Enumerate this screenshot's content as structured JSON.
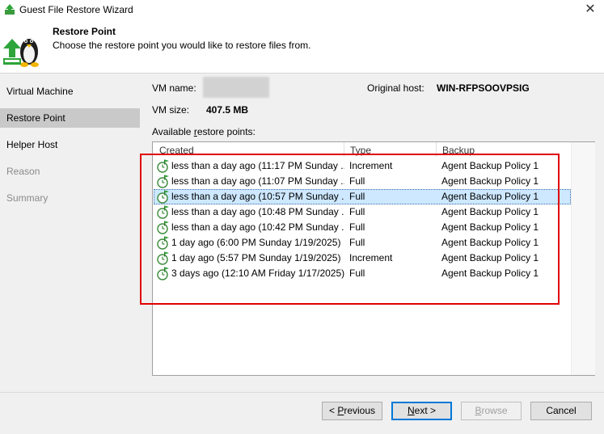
{
  "window": {
    "title": "Guest File Restore Wizard",
    "close_symbol": "✕"
  },
  "header": {
    "title": "Restore Point",
    "description": "Choose the restore point you would like to restore files from."
  },
  "sidebar": {
    "items": [
      {
        "label": "Virtual Machine",
        "state": "normal"
      },
      {
        "label": "Restore Point",
        "state": "active"
      },
      {
        "label": "Helper Host",
        "state": "normal"
      },
      {
        "label": "Reason",
        "state": "disabled"
      },
      {
        "label": "Summary",
        "state": "disabled"
      }
    ]
  },
  "vm": {
    "name_label": "VM name:",
    "size_label": "VM size:",
    "size_value": "407.5 MB",
    "original_host_label": "Original host:",
    "original_host_value": "WIN-RFPSOOVPSIG"
  },
  "restore_points": {
    "label_prefix": "Available ",
    "label_underlined": "r",
    "label_suffix": "estore points:",
    "columns": [
      "Created",
      "Type",
      "Backup"
    ],
    "rows": [
      {
        "created": "less than a day ago (11:17 PM Sunday ...",
        "type": "Increment",
        "backup": "Agent Backup Policy 1",
        "selected": false
      },
      {
        "created": "less than a day ago (11:07 PM Sunday ...",
        "type": "Full",
        "backup": "Agent Backup Policy 1",
        "selected": false
      },
      {
        "created": "less than a day ago (10:57 PM Sunday ...",
        "type": "Full",
        "backup": "Agent Backup Policy 1",
        "selected": true
      },
      {
        "created": "less than a day ago (10:48 PM Sunday ...",
        "type": "Full",
        "backup": "Agent Backup Policy 1",
        "selected": false
      },
      {
        "created": "less than a day ago (10:42 PM Sunday ...",
        "type": "Full",
        "backup": "Agent Backup Policy 1",
        "selected": false
      },
      {
        "created": "1 day ago (6:00 PM Sunday 1/19/2025)",
        "type": "Full",
        "backup": "Agent Backup Policy 1",
        "selected": false
      },
      {
        "created": "1 day ago (5:57 PM Sunday 1/19/2025)",
        "type": "Increment",
        "backup": "Agent Backup Policy 1",
        "selected": false
      },
      {
        "created": "3 days ago (12:10 AM Friday 1/17/2025)",
        "type": "Full",
        "backup": "Agent Backup Policy 1",
        "selected": false
      }
    ],
    "row_icon": "restore-point-clock-icon"
  },
  "buttons": {
    "previous": {
      "prefix": "< ",
      "u": "P",
      "rest": "revious"
    },
    "next": {
      "u": "N",
      "rest": "ext >"
    },
    "browse": {
      "u": "B",
      "rest": "rowse"
    },
    "cancel": "Cancel"
  },
  "colors": {
    "selection": "#cde8ff",
    "highlight_box": "#e00000",
    "logo_green": "#2ea43a"
  }
}
